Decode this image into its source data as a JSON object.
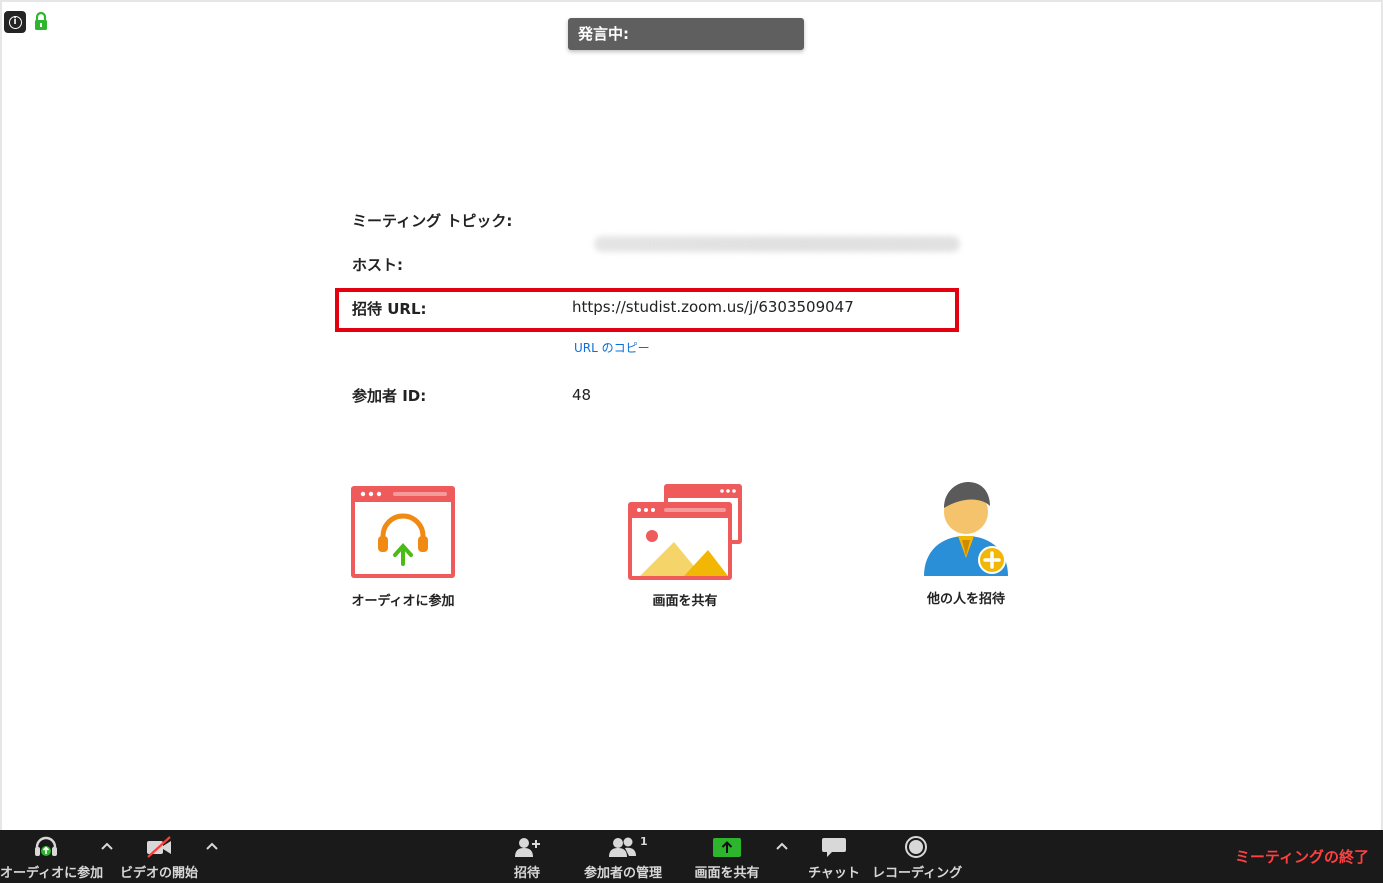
{
  "header": {
    "speaking_label": "発言中:"
  },
  "meeting_info": {
    "topic_label": "ミーティング トピック:",
    "host_label": "ホスト:",
    "invite_url_label": "招待 URL:",
    "invite_url": "https://studist.zoom.us/j/6303509047",
    "copy_url_label": "URL のコピー",
    "participant_id_label": "参加者 ID:",
    "participant_id": "48",
    "highlight_color": "#e3000f"
  },
  "actions": [
    {
      "label": "オーディオに参加",
      "icon": "join-audio-icon"
    },
    {
      "label": "画面を共有",
      "icon": "share-screen-icon"
    },
    {
      "label": "他の人を招待",
      "icon": "invite-person-icon"
    }
  ],
  "toolbar": {
    "join_audio": "オーディオに参加",
    "start_video": "ビデオの開始",
    "invite": "招待",
    "manage_participants": "参加者の管理",
    "participant_count": "1",
    "share_screen": "画面を共有",
    "chat": "チャット",
    "recording": "レコーディング",
    "end_meeting": "ミーティングの終了"
  },
  "colors": {
    "toolbar_bg": "#1a1a1a",
    "end_meeting": "#ff4040",
    "share_green": "#2db52d",
    "link_blue": "#0b6fd6"
  }
}
